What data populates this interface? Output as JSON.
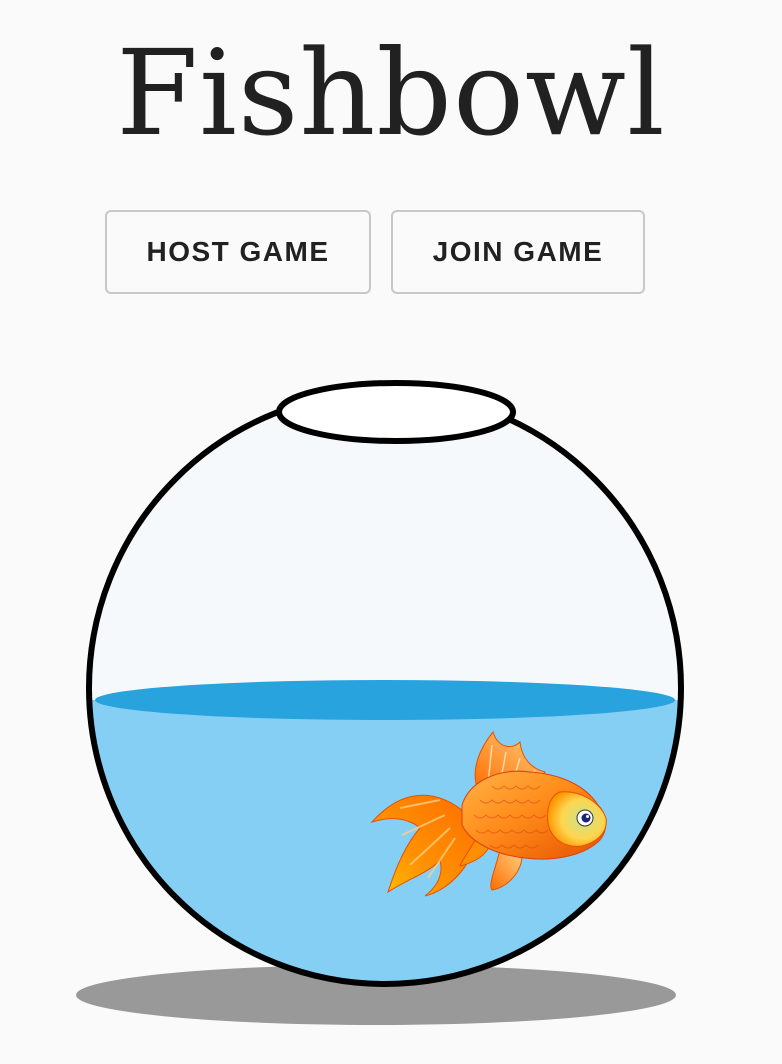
{
  "app": {
    "title": "Fishbowl"
  },
  "actions": {
    "host_label": "HOST GAME",
    "join_label": "JOIN GAME"
  },
  "illustration": {
    "subject": "fishbowl-with-goldfish",
    "colors": {
      "water": "#85cff5",
      "water_surface": "#29a3dd",
      "bowl_outline": "#000000",
      "shadow": "#999999",
      "fish": "#ff8c1a"
    }
  }
}
